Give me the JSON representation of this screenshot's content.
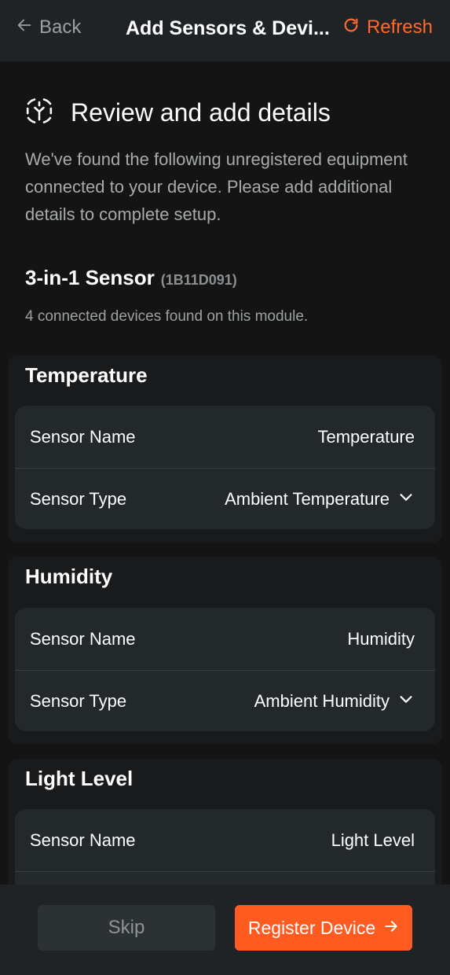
{
  "header": {
    "back_label": "Back",
    "title": "Add Sensors & Devi...",
    "refresh_label": "Refresh"
  },
  "intro": {
    "title": "Review and add details",
    "description": "We've found the following unregistered equipment connected to your device. Please add additional details to complete setup."
  },
  "module": {
    "name": "3-in-1 Sensor",
    "id": "(1B11D091)",
    "count_text": "4 connected devices found on this module."
  },
  "sections": [
    {
      "title": "Temperature",
      "name_label": "Sensor Name",
      "name_value": "Temperature",
      "type_label": "Sensor Type",
      "type_value": "Ambient Temperature"
    },
    {
      "title": "Humidity",
      "name_label": "Sensor Name",
      "name_value": "Humidity",
      "type_label": "Sensor Type",
      "type_value": "Ambient Humidity"
    },
    {
      "title": "Light Level",
      "name_label": "Sensor Name",
      "name_value": "Light Level"
    }
  ],
  "footer": {
    "skip_label": "Skip",
    "register_label": "Register Device"
  },
  "colors": {
    "accent": "#ff5a1f",
    "background": "#141414",
    "card": "#23282b"
  }
}
